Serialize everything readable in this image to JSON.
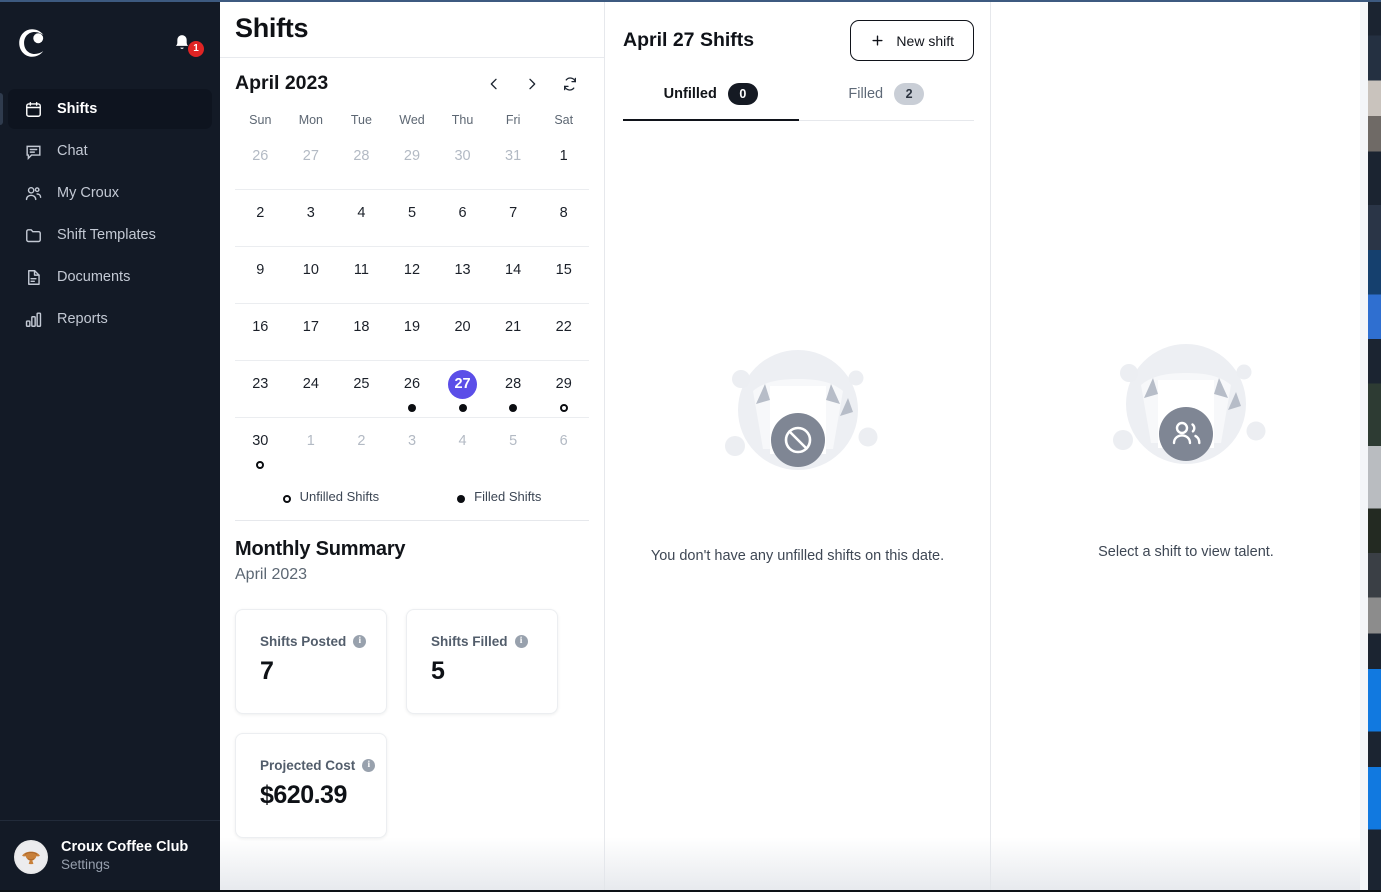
{
  "app": {
    "brand_logo": "croux-c-logo",
    "accent_color": "#5b4ee8",
    "sidebar_bg": "#131a26"
  },
  "sidebar": {
    "notifications": {
      "icon": "bell-icon",
      "badge_count": "1"
    },
    "items": [
      {
        "label": "Shifts",
        "icon": "calendar-icon",
        "active": true
      },
      {
        "label": "Chat",
        "icon": "chat-bubble-icon",
        "active": false
      },
      {
        "label": "My Croux",
        "icon": "users-icon",
        "active": false
      },
      {
        "label": "Shift Templates",
        "icon": "folder-icon",
        "active": false
      },
      {
        "label": "Documents",
        "icon": "document-icon",
        "active": false
      },
      {
        "label": "Reports",
        "icon": "bar-chart-icon",
        "active": false
      }
    ],
    "account": {
      "name": "Croux Coffee Club",
      "sub": "Settings",
      "avatar": "croissant-avatar"
    }
  },
  "header": {
    "title": "Shifts"
  },
  "calendar": {
    "month_label": "April 2023",
    "prev_icon": "chevron-left-icon",
    "next_icon": "chevron-right-icon",
    "refresh_icon": "refresh-icon",
    "day_names": [
      "Sun",
      "Mon",
      "Tue",
      "Wed",
      "Thu",
      "Fri",
      "Sat"
    ],
    "selected_day": 27,
    "weeks": [
      [
        {
          "n": "26",
          "muted": true,
          "dot": "none"
        },
        {
          "n": "27",
          "muted": true,
          "dot": "none"
        },
        {
          "n": "28",
          "muted": true,
          "dot": "none"
        },
        {
          "n": "29",
          "muted": true,
          "dot": "none"
        },
        {
          "n": "30",
          "muted": true,
          "dot": "none"
        },
        {
          "n": "31",
          "muted": true,
          "dot": "none"
        },
        {
          "n": "1",
          "muted": false,
          "dot": "none"
        }
      ],
      [
        {
          "n": "2",
          "muted": false,
          "dot": "none"
        },
        {
          "n": "3",
          "muted": false,
          "dot": "none"
        },
        {
          "n": "4",
          "muted": false,
          "dot": "none"
        },
        {
          "n": "5",
          "muted": false,
          "dot": "none"
        },
        {
          "n": "6",
          "muted": false,
          "dot": "none"
        },
        {
          "n": "7",
          "muted": false,
          "dot": "none"
        },
        {
          "n": "8",
          "muted": false,
          "dot": "none"
        }
      ],
      [
        {
          "n": "9",
          "muted": false,
          "dot": "none"
        },
        {
          "n": "10",
          "muted": false,
          "dot": "none"
        },
        {
          "n": "11",
          "muted": false,
          "dot": "none"
        },
        {
          "n": "12",
          "muted": false,
          "dot": "none"
        },
        {
          "n": "13",
          "muted": false,
          "dot": "none"
        },
        {
          "n": "14",
          "muted": false,
          "dot": "none"
        },
        {
          "n": "15",
          "muted": false,
          "dot": "none"
        }
      ],
      [
        {
          "n": "16",
          "muted": false,
          "dot": "none"
        },
        {
          "n": "17",
          "muted": false,
          "dot": "none"
        },
        {
          "n": "18",
          "muted": false,
          "dot": "none"
        },
        {
          "n": "19",
          "muted": false,
          "dot": "none"
        },
        {
          "n": "20",
          "muted": false,
          "dot": "none"
        },
        {
          "n": "21",
          "muted": false,
          "dot": "none"
        },
        {
          "n": "22",
          "muted": false,
          "dot": "none"
        }
      ],
      [
        {
          "n": "23",
          "muted": false,
          "dot": "none"
        },
        {
          "n": "24",
          "muted": false,
          "dot": "none"
        },
        {
          "n": "25",
          "muted": false,
          "dot": "none"
        },
        {
          "n": "26",
          "muted": false,
          "dot": "filled"
        },
        {
          "n": "27",
          "muted": false,
          "dot": "filled",
          "selected": true
        },
        {
          "n": "28",
          "muted": false,
          "dot": "filled"
        },
        {
          "n": "29",
          "muted": false,
          "dot": "unfilled"
        }
      ],
      [
        {
          "n": "30",
          "muted": false,
          "dot": "unfilled"
        },
        {
          "n": "1",
          "muted": true,
          "dot": "none"
        },
        {
          "n": "2",
          "muted": true,
          "dot": "none"
        },
        {
          "n": "3",
          "muted": true,
          "dot": "none"
        },
        {
          "n": "4",
          "muted": true,
          "dot": "none"
        },
        {
          "n": "5",
          "muted": true,
          "dot": "none"
        },
        {
          "n": "6",
          "muted": true,
          "dot": "none"
        }
      ]
    ],
    "legend": [
      {
        "label": "Unfilled Shifts",
        "style": "unfilled"
      },
      {
        "label": "Filled Shifts",
        "style": "filled"
      }
    ]
  },
  "summary": {
    "title": "Monthly Summary",
    "subtitle": "April 2023",
    "cards": [
      {
        "label": "Shifts Posted",
        "value": "7",
        "info_icon": "info-icon"
      },
      {
        "label": "Shifts Filled",
        "value": "5",
        "info_icon": "info-icon"
      },
      {
        "label": "Projected Cost",
        "value": "$620.39",
        "info_icon": "info-icon"
      }
    ]
  },
  "shifts_panel": {
    "title": "April 27 Shifts",
    "new_shift_label": "New shift",
    "new_shift_icon": "plus-icon",
    "tabs": [
      {
        "label": "Unfilled",
        "count": "0",
        "active": true
      },
      {
        "label": "Filled",
        "count": "2",
        "active": false
      }
    ],
    "empty_message": "You don't have any unfilled shifts on this date.",
    "empty_illustration": "no-shifts-illustration"
  },
  "talent_panel": {
    "message": "Select a shift to view talent.",
    "illustration": "select-shift-illustration"
  }
}
